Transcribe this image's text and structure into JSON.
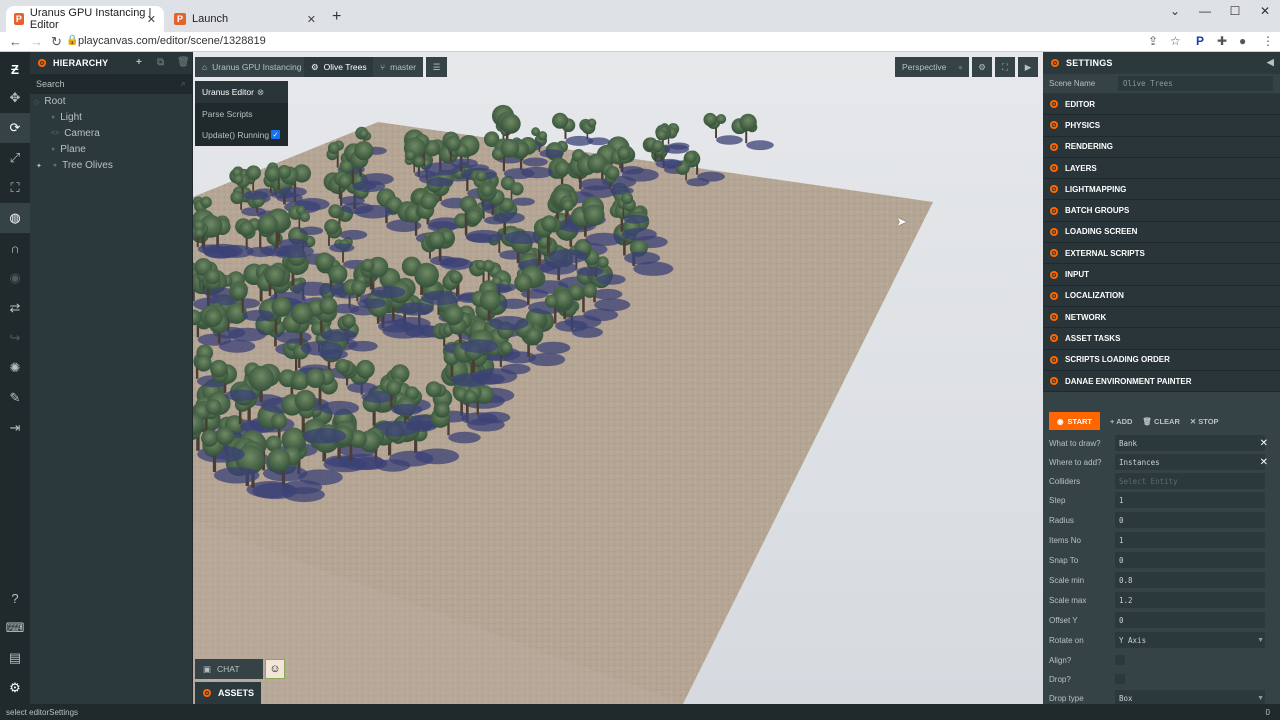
{
  "browser": {
    "tabs": [
      {
        "title": "Uranus GPU Instancing | Editor",
        "active": true
      },
      {
        "title": "Launch",
        "active": false
      }
    ],
    "url": "playcanvas.com/editor/scene/1328819",
    "accent": "#e4632d"
  },
  "toolbar": {
    "icons": [
      "playcanvas-logo-icon",
      "translate-icon",
      "rotate-icon",
      "scale-icon",
      "resize-icon",
      "world-icon",
      "snap-icon",
      "focus-icon",
      "undo-icon",
      "redo-icon",
      "lightmap-icon",
      "code-icon",
      "publish-icon",
      "help-icon",
      "controls-icon",
      "chat-icon",
      "settings-icon"
    ]
  },
  "hierarchy": {
    "title": "HIERARCHY",
    "search_placeholder": "Search",
    "items": [
      "Root",
      "Light",
      "Camera",
      "Plane",
      "Tree Olives"
    ]
  },
  "viewport": {
    "breadcrumb_project": "Uranus GPU Instancing",
    "breadcrumb_scene": "Olive Trees",
    "branch": "master",
    "camera": "Perspective",
    "editor_panel": {
      "title": "Uranus Editor",
      "parse_scripts": "Parse Scripts",
      "update_running": "Update() Running",
      "update_checked": true
    },
    "chat_label": "CHAT",
    "assets_label": "ASSETS",
    "ground_color": "#b8a898",
    "sky_color": "#e4e6e9"
  },
  "settings": {
    "title": "SETTINGS",
    "scene_name_label": "Scene Name",
    "scene_name_value": "Olive Trees",
    "sections": [
      "EDITOR",
      "PHYSICS",
      "RENDERING",
      "LAYERS",
      "LIGHTMAPPING",
      "BATCH GROUPS",
      "LOADING SCREEN",
      "EXTERNAL SCRIPTS",
      "INPUT",
      "LOCALIZATION",
      "NETWORK",
      "ASSET TASKS",
      "SCRIPTS LOADING ORDER",
      "DANAE ENVIRONMENT PAINTER"
    ],
    "painter": {
      "start": "START",
      "add": "ADD",
      "clear": "CLEAR",
      "stop": "STOP",
      "what_to_draw_label": "What to draw?",
      "what_to_draw_value": "Bank",
      "where_to_add_label": "Where to add?",
      "where_to_add_value": "Instances",
      "colliders_label": "Colliders",
      "colliders_value": "Select Entity",
      "step_label": "Step",
      "step_value": "1",
      "radius_label": "Radius",
      "radius_value": "0",
      "items_no_label": "Items No",
      "items_no_value": "1",
      "snap_to_label": "Snap To",
      "snap_to_value": "0",
      "scale_min_label": "Scale min",
      "scale_min_value": "0.8",
      "scale_max_label": "Scale max",
      "scale_max_value": "1.2",
      "offset_y_label": "Offset Y",
      "offset_y_value": "0",
      "rotate_on_label": "Rotate on",
      "rotate_on_value": "Y Axis",
      "align_label": "Align?",
      "drop_label": "Drop?",
      "drop_type_label": "Drop type",
      "drop_type_value": "Box"
    }
  },
  "status": {
    "message": "select editorSettings",
    "count": "0"
  }
}
